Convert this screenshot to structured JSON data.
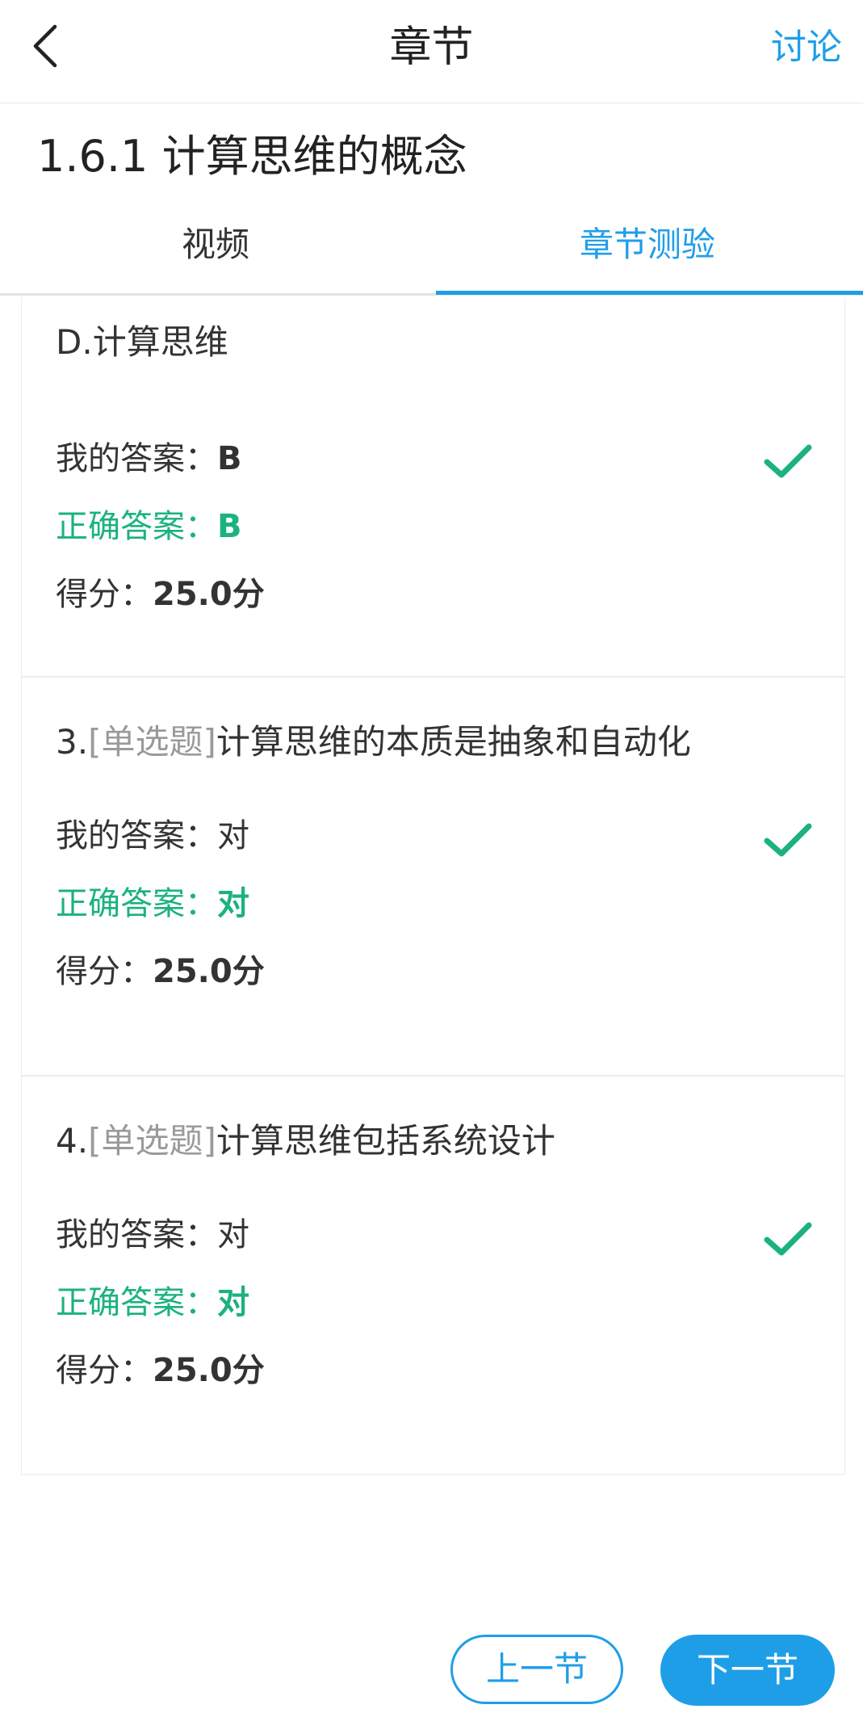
{
  "header": {
    "title": "章节",
    "discuss_label": "讨论"
  },
  "lesson": {
    "title": "1.6.1 计算思维的概念"
  },
  "tabs": [
    {
      "label": "视频",
      "active": false
    },
    {
      "label": "章节测验",
      "active": true
    }
  ],
  "questions": [
    {
      "option_text": "D.计算思维",
      "my_answer_label": "我的答案：",
      "my_answer_value": "B",
      "correct_answer_label": "正确答案：",
      "correct_answer_value": "B",
      "score_label": "得分：",
      "score_value": "25.0分",
      "is_correct": true
    },
    {
      "number": "3.",
      "type": "[单选题]",
      "stem": "计算思维的本质是抽象和自动化",
      "my_answer_label": "我的答案：",
      "my_answer_value": "对",
      "correct_answer_label": "正确答案：",
      "correct_answer_value": "对",
      "score_label": "得分：",
      "score_value": "25.0分",
      "is_correct": true
    },
    {
      "number": "4.",
      "type": "[单选题]",
      "stem": "计算思维包括系统设计",
      "my_answer_label": "我的答案：",
      "my_answer_value": "对",
      "correct_answer_label": "正确答案：",
      "correct_answer_value": "对",
      "score_label": "得分：",
      "score_value": "25.0分",
      "is_correct": true
    }
  ],
  "nav": {
    "prev_label": "上一节",
    "next_label": "下一节"
  },
  "colors": {
    "accent": "#1f9ee8",
    "correct": "#1bb27f",
    "text": "#333333",
    "muted": "#9a9a9a"
  }
}
